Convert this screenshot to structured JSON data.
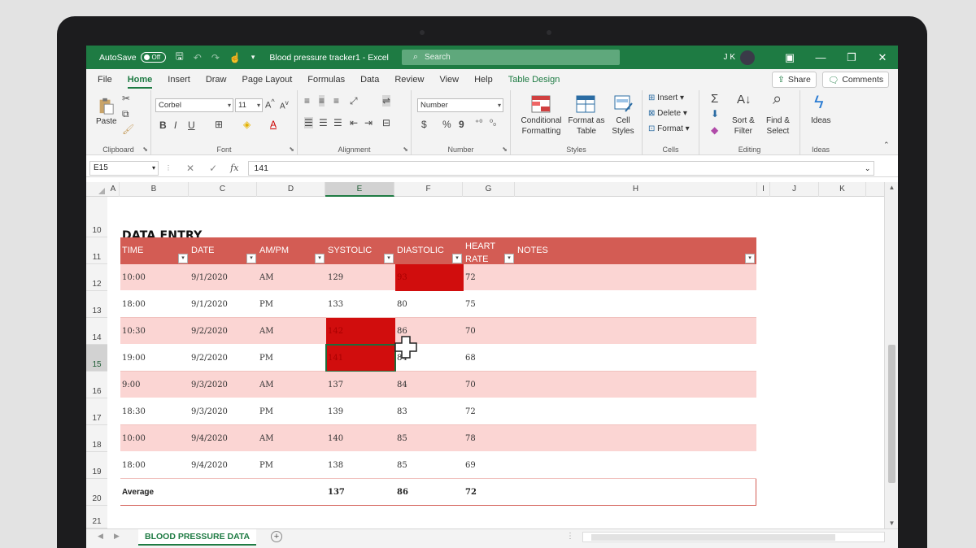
{
  "titlebar": {
    "autosave_label": "AutoSave",
    "autosave_state": "Off",
    "doc_title": "Blood pressure tracker1  -  Excel",
    "search_placeholder": "Search",
    "user_initials": "J K"
  },
  "menu": {
    "tabs": [
      "File",
      "Home",
      "Insert",
      "Draw",
      "Page Layout",
      "Formulas",
      "Data",
      "Review",
      "View",
      "Help",
      "Table Design"
    ],
    "active": "Home",
    "share_label": "Share",
    "comments_label": "Comments"
  },
  "ribbon": {
    "clipboard": {
      "paste": "Paste",
      "label": "Clipboard"
    },
    "font": {
      "name": "Corbel",
      "size": "11",
      "bold": "B",
      "italic": "I",
      "underline": "U",
      "label": "Font"
    },
    "alignment": {
      "label": "Alignment"
    },
    "number": {
      "format": "Number",
      "currency": "$",
      "percent": "%",
      "comma": "9",
      "label": "Number"
    },
    "styles": {
      "conditional_formatting": [
        "Conditional",
        "Formatting"
      ],
      "format_as_table": [
        "Format as",
        "Table"
      ],
      "cell_styles": [
        "Cell",
        "Styles"
      ],
      "label": "Styles"
    },
    "cells": {
      "insert": "Insert",
      "delete": "Delete",
      "format": "Format",
      "label": "Cells"
    },
    "editing": {
      "sum": "Σ",
      "sort_filter": [
        "Sort &",
        "Filter"
      ],
      "find_select": [
        "Find &",
        "Select"
      ],
      "label": "Editing"
    },
    "ideas": {
      "ideas": "Ideas",
      "label": "Ideas"
    }
  },
  "formula_bar": {
    "name_box": "E15",
    "cancel": "✕",
    "enter": "✓",
    "fx": "fx",
    "value": "141"
  },
  "columns": [
    "A",
    "B",
    "C",
    "D",
    "E",
    "F",
    "G",
    "H",
    "I",
    "J",
    "K"
  ],
  "selected_column": "E",
  "rows": [
    "10",
    "11",
    "12",
    "13",
    "14",
    "15",
    "16",
    "17",
    "18",
    "19",
    "20",
    "21"
  ],
  "selected_row": "15",
  "sheet_title": "DATA ENTRY",
  "table": {
    "headers": [
      "TIME",
      "DATE",
      "AM/PM",
      "SYSTOLIC",
      "DIASTOLIC",
      "HEART RATE",
      "NOTES"
    ],
    "rows": [
      [
        "10:00",
        "9/1/2020",
        "AM",
        "129",
        "93",
        "72",
        ""
      ],
      [
        "18:00",
        "9/1/2020",
        "PM",
        "133",
        "80",
        "75",
        ""
      ],
      [
        "10:30",
        "9/2/2020",
        "AM",
        "142",
        "86",
        "70",
        ""
      ],
      [
        "19:00",
        "9/2/2020",
        "PM",
        "141",
        "84",
        "68",
        ""
      ],
      [
        "9:00",
        "9/3/2020",
        "AM",
        "137",
        "84",
        "70",
        ""
      ],
      [
        "18:30",
        "9/3/2020",
        "PM",
        "139",
        "83",
        "72",
        ""
      ],
      [
        "10:00",
        "9/4/2020",
        "AM",
        "140",
        "85",
        "78",
        ""
      ],
      [
        "18:00",
        "9/4/2020",
        "PM",
        "138",
        "85",
        "69",
        ""
      ]
    ],
    "average": {
      "label": "Average",
      "systolic": "137",
      "diastolic": "86",
      "heart_rate": "72"
    }
  },
  "sheet_tab": "BLOOD PRESSURE DATA",
  "colors": {
    "excel_green": "#1e7b43",
    "header_red": "#d35c54",
    "band_pink": "#fbd5d3",
    "alert_red": "#d10d0d"
  }
}
